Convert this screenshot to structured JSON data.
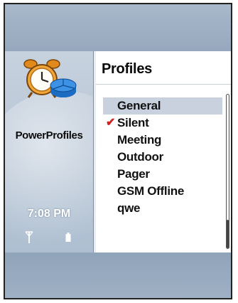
{
  "app": {
    "name": "PowerProfiles",
    "icon": "alarm-clock-pie-icon"
  },
  "status": {
    "time": "7:08 PM",
    "signal_icon": "signal-antenna-icon",
    "battery_icon": "battery-icon"
  },
  "panel": {
    "title": "Profiles",
    "items": [
      {
        "label": "General",
        "highlighted": true,
        "active": false
      },
      {
        "label": "Silent",
        "highlighted": false,
        "active": true
      },
      {
        "label": "Meeting",
        "highlighted": false,
        "active": false
      },
      {
        "label": "Outdoor",
        "highlighted": false,
        "active": false
      },
      {
        "label": "Pager",
        "highlighted": false,
        "active": false
      },
      {
        "label": "GSM Offline",
        "highlighted": false,
        "active": false
      },
      {
        "label": "qwe",
        "highlighted": false,
        "active": false
      }
    ],
    "check_icon": "checkmark-icon",
    "check_glyph": "✔"
  },
  "colors": {
    "highlight": "#c9d0de",
    "check": "#d02020",
    "background": "#9fb0c4"
  }
}
